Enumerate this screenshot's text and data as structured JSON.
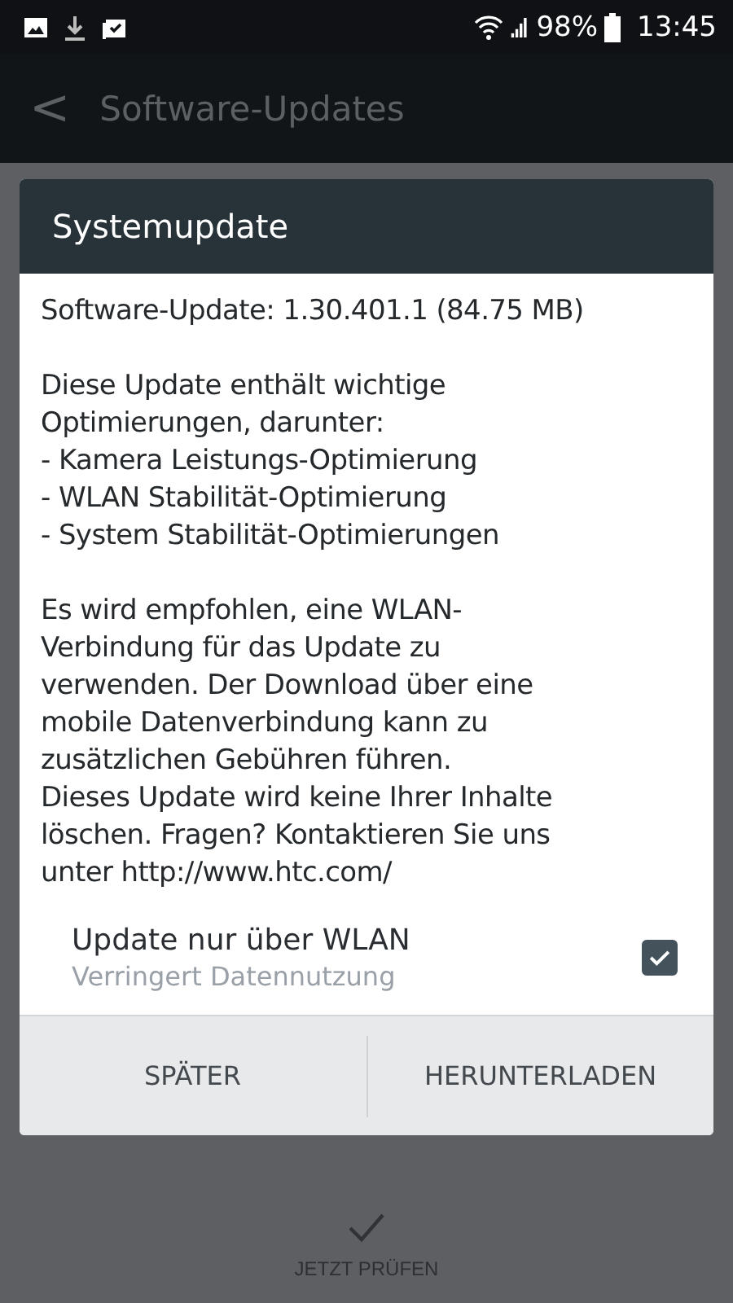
{
  "status_bar": {
    "battery": "98%",
    "time": "13:45"
  },
  "app_bar": {
    "back": "<",
    "title": "Software-Updates"
  },
  "dialog": {
    "title": "Systemupdate",
    "version": "Software-Update: 1.30.401.1 (84.75 MB)",
    "description": "Diese Update enthält wichtige\nOptimierungen, darunter:\n- Kamera Leistungs-Optimierung\n- WLAN Stabilität-Optimierung\n- System Stabilität-Optimierungen",
    "notice": "Es wird empfohlen, eine WLAN-\nVerbindung für das Update zu\nverwenden. Der Download über eine\nmobile Datenverbindung kann zu\nzusätzlichen Gebühren führen.\nDieses Update wird keine Ihrer Inhalte\nlöschen. Fragen? Kontaktieren Sie uns\nunter http://www.htc.com/",
    "option": {
      "label": "Update nur über WLAN",
      "summary": "Verringert Datennutzung",
      "checked": true
    },
    "buttons": [
      "SPÄTER",
      "HERUNTERLADEN"
    ]
  },
  "bottom_action": {
    "label": "JETZT PRÜFEN"
  }
}
